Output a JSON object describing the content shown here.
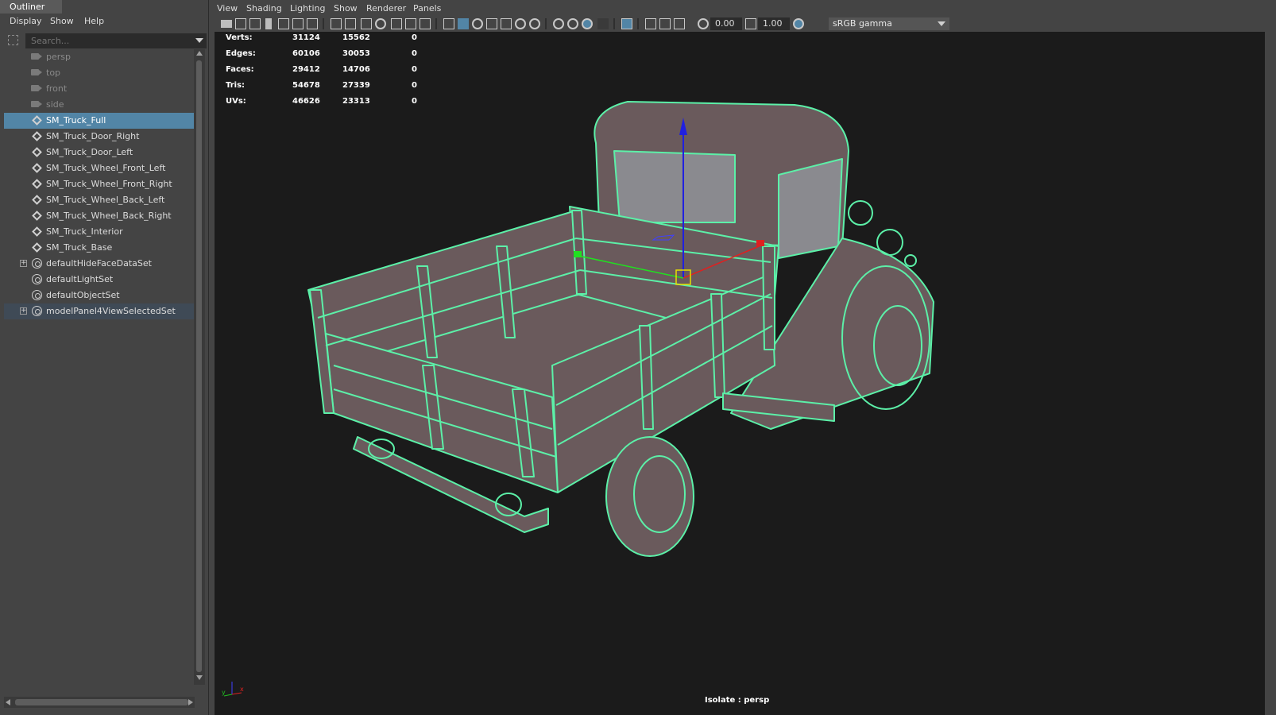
{
  "outliner": {
    "title": "Outliner",
    "menu": [
      "Display",
      "Show",
      "Help"
    ],
    "search_placeholder": "Search...",
    "items": [
      {
        "label": "persp",
        "icon": "camera-icon",
        "dim": true
      },
      {
        "label": "top",
        "icon": "camera-icon",
        "dim": true
      },
      {
        "label": "front",
        "icon": "camera-icon",
        "dim": true
      },
      {
        "label": "side",
        "icon": "camera-icon",
        "dim": true
      },
      {
        "label": "SM_Truck_Full",
        "icon": "mesh-icon",
        "selected": true
      },
      {
        "label": "SM_Truck_Door_Right",
        "icon": "mesh-icon"
      },
      {
        "label": "SM_Truck_Door_Left",
        "icon": "mesh-icon"
      },
      {
        "label": "SM_Truck_Wheel_Front_Left",
        "icon": "mesh-icon"
      },
      {
        "label": "SM_Truck_Wheel_Front_Right",
        "icon": "mesh-icon"
      },
      {
        "label": "SM_Truck_Wheel_Back_Left",
        "icon": "mesh-icon"
      },
      {
        "label": "SM_Truck_Wheel_Back_Right",
        "icon": "mesh-icon"
      },
      {
        "label": "SM_Truck_Interior",
        "icon": "mesh-icon"
      },
      {
        "label": "SM_Truck_Base",
        "icon": "mesh-icon"
      },
      {
        "label": "defaultHideFaceDataSet",
        "icon": "set-icon",
        "expandable": true
      },
      {
        "label": "defaultLightSet",
        "icon": "set-icon"
      },
      {
        "label": "defaultObjectSet",
        "icon": "set-icon"
      },
      {
        "label": "modelPanel4ViewSelectedSet",
        "icon": "set-icon",
        "expandable": true,
        "highlight": true
      }
    ]
  },
  "panel": {
    "menu": [
      "View",
      "Shading",
      "Lighting",
      "Show",
      "Renderer",
      "Panels"
    ],
    "toolbar": {
      "exposure": "0.00",
      "gamma": "1.00",
      "color_space": "sRGB gamma"
    }
  },
  "hud": {
    "rows": [
      {
        "label": "Verts:",
        "a": "31124",
        "b": "15562",
        "c": "0"
      },
      {
        "label": "Edges:",
        "a": "60106",
        "b": "30053",
        "c": "0"
      },
      {
        "label": "Faces:",
        "a": "29412",
        "b": "14706",
        "c": "0"
      },
      {
        "label": "Tris:",
        "a": "54678",
        "b": "27339",
        "c": "0"
      },
      {
        "label": "UVs:",
        "a": "46626",
        "b": "23313",
        "c": "0"
      }
    ],
    "isolate": "Isolate : persp",
    "axis": {
      "y": "y",
      "x": "x"
    }
  },
  "colors": {
    "wire": "#5cf0a8",
    "body": "#6a5a5c",
    "selected_row": "#5285a6",
    "viewport_bg": "#1b1b1b"
  }
}
